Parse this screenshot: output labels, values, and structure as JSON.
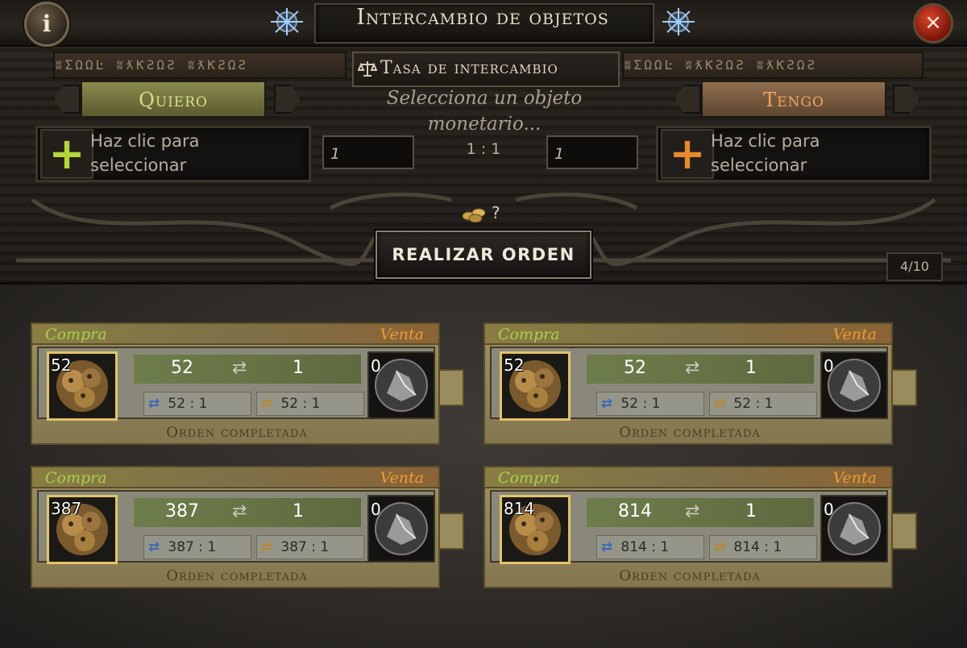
{
  "window": {
    "title": "Intercambio de objetos",
    "info_symbol": "i",
    "close_symbol": "×"
  },
  "rune_text": "ʬΣΩΩĿ ʬƛƘƧΩƧ ʬƛƘƧΩƧ",
  "exchange": {
    "rate_label": "Tasa de intercambio",
    "hint": "Selecciona un objeto monetario...",
    "ratio": "1 : 1",
    "want_tab": "Quiero",
    "have_tab": "Tengo",
    "want_selector": "Haz clic para seleccionar",
    "have_selector": "Haz clic para seleccionar",
    "want_quantity": "1",
    "have_quantity": "1",
    "coin_info": "?",
    "place_order_button": "REALIZAR ORDEN",
    "page_counter": "4/10",
    "icons": {
      "scale": "scale-icon",
      "plus": "plus-icon",
      "coins": "coins-icon"
    },
    "colors": {
      "want_accent": "#b5d53a",
      "have_accent": "#e8892f"
    }
  },
  "orders": [
    {
      "buy_label": "Compra",
      "sell_label": "Venta",
      "buy_stack": "52",
      "sell_stack": "0",
      "buy_amount": "52",
      "sell_amount": "1",
      "rate_left": "52 : 1",
      "rate_right": "52 : 1",
      "status": "Orden completada"
    },
    {
      "buy_label": "Compra",
      "sell_label": "Venta",
      "buy_stack": "52",
      "sell_stack": "0",
      "buy_amount": "52",
      "sell_amount": "1",
      "rate_left": "52 : 1",
      "rate_right": "52 : 1",
      "status": "Orden completada"
    },
    {
      "buy_label": "Compra",
      "sell_label": "Venta",
      "buy_stack": "387",
      "sell_stack": "0",
      "buy_amount": "387",
      "sell_amount": "1",
      "rate_left": "387 : 1",
      "rate_right": "387 : 1",
      "status": "Orden completada"
    },
    {
      "buy_label": "Compra",
      "sell_label": "Venta",
      "buy_stack": "814",
      "sell_stack": "0",
      "buy_amount": "814",
      "sell_amount": "1",
      "rate_left": "814 : 1",
      "rate_right": "814 : 1",
      "status": "Orden completada"
    }
  ]
}
